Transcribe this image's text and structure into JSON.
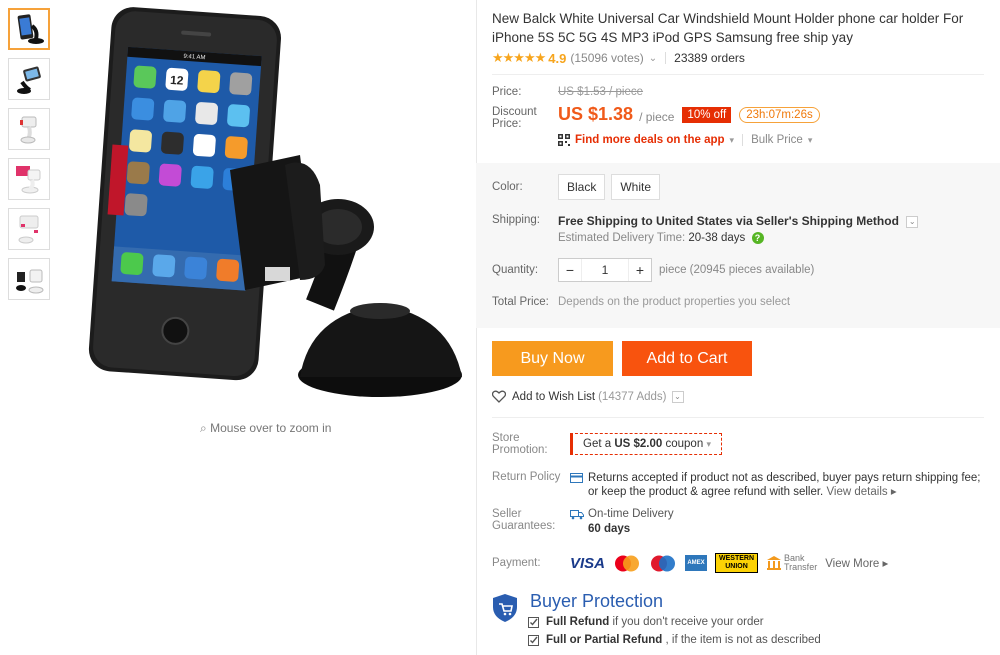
{
  "product": {
    "title": "New Balck White Universal Car Windshield Mount Holder phone car holder For iPhone 5S 5C 5G 4S MP3 iPod GPS Samsung free ship yay",
    "stars": "★★★★★",
    "rating": "4.9",
    "votes": "(15096 votes)",
    "orders": "23389 orders"
  },
  "gallery": {
    "zoom_hint": "Mouse over to zoom in",
    "phone_time": "9:41 AM",
    "phone_date": "12"
  },
  "price": {
    "label": "Price:",
    "original": "US $1.53 / piece",
    "discount_label": "Discount Price:",
    "current": "US $1.38",
    "per": "/ piece",
    "off_badge": "10% off",
    "timer": "23h:07m:26s",
    "app_deals": "Find more deals on the app",
    "bulk": "Bulk Price"
  },
  "options": {
    "color_label": "Color:",
    "colors": [
      "Black",
      "White"
    ],
    "shipping_label": "Shipping:",
    "shipping_main": "Free Shipping to United States via Seller's Shipping Method",
    "est_label": "Estimated Delivery Time:",
    "est_days": "20-38 days",
    "quantity_label": "Quantity:",
    "quantity_value": "1",
    "quantity_minus": "−",
    "quantity_plus": "+",
    "quantity_note": "piece (20945 pieces available)",
    "total_label": "Total Price:",
    "total_value": "Depends on the product properties you select"
  },
  "actions": {
    "buy_now": "Buy Now",
    "add_to_cart": "Add to Cart",
    "wish_list": "Add to Wish List",
    "wish_count": "(14377 Adds)"
  },
  "store": {
    "promotion_label": "Store Promotion:",
    "coupon_prefix": "Get a",
    "coupon_amount": "US $2.00",
    "coupon_suffix": "coupon",
    "return_label": "Return Policy",
    "return_text": "Returns accepted if product not as described, buyer pays return shipping fee; or keep the product & agree refund with seller.",
    "return_link": "View details",
    "guarantee_label": "Seller Guarantees:",
    "ontime": "On-time Delivery",
    "ontime_days": "60 days",
    "payment_label": "Payment:",
    "visa": "VISA",
    "amex": "AMEX",
    "wu_line1": "WESTERN",
    "wu_line2": "UNION",
    "bank_line1": "Bank",
    "bank_line2": "Transfer",
    "view_more": "View More"
  },
  "protection": {
    "title": "Buyer Protection",
    "line1_bold": "Full Refund",
    "line1_rest": "if you don't receive your order",
    "line2_bold": "Full or Partial Refund",
    "line2_rest": ", if the item is not as described"
  },
  "colors": {
    "orange_price": "#f05a1a",
    "buy_now": "#f79a1e",
    "add_to_cart": "#f8530e",
    "protection_blue": "#2a5db0"
  }
}
